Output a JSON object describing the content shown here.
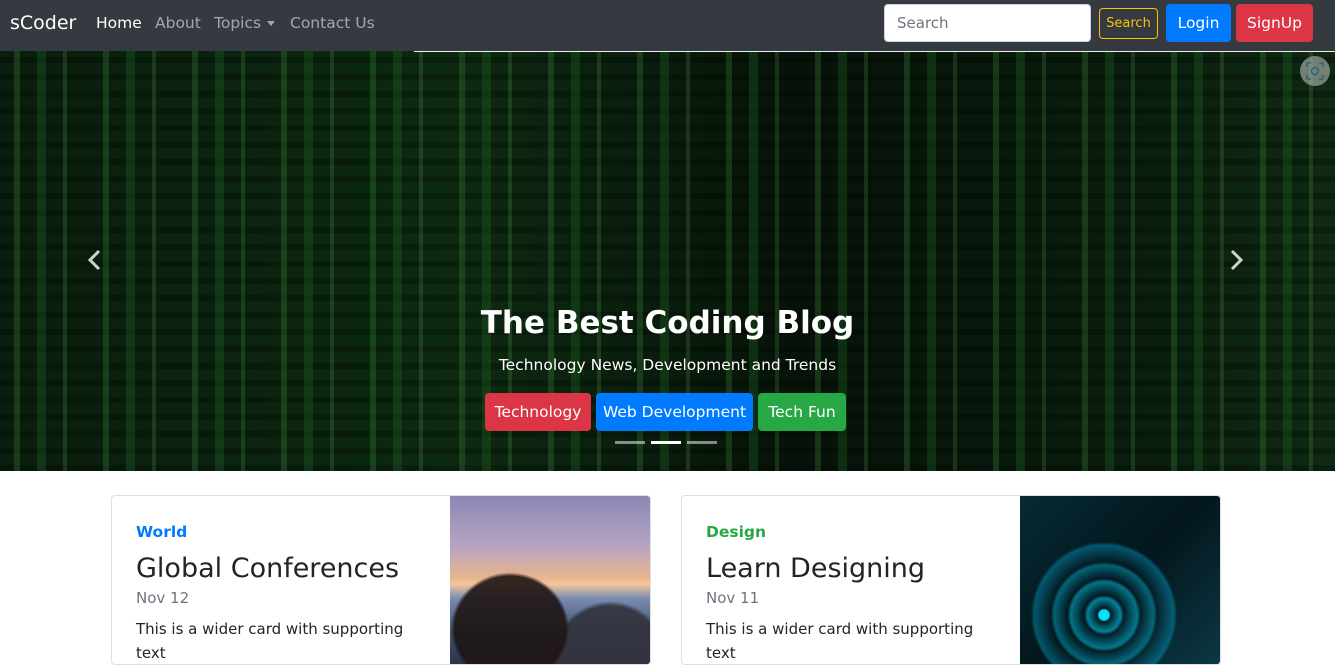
{
  "navbar": {
    "brand": "sCoder",
    "links": [
      {
        "label": "Home",
        "active": true
      },
      {
        "label": "About",
        "active": false
      },
      {
        "label": "Topics",
        "active": false,
        "dropdown": true
      },
      {
        "label": "Contact Us",
        "active": false
      }
    ],
    "search_placeholder": "Search",
    "search_button": "Search",
    "login_button": "Login",
    "signup_button": "SignUp"
  },
  "hero": {
    "title": "The Best Coding Blog",
    "subtitle": "Technology News, Development and Trends",
    "buttons": [
      "Technology",
      "Web Development",
      "Tech Fun"
    ],
    "active_slide": 2,
    "slide_count": 3
  },
  "cards": [
    {
      "category": "World",
      "title": "Global Conferences",
      "date": "Nov 12",
      "text": "This is a wider card with supporting text"
    },
    {
      "category": "Design",
      "title": "Learn Designing",
      "date": "Nov 11",
      "text": "This is a wider card with supporting text"
    }
  ],
  "colors": {
    "navbar_bg": "#343a40",
    "primary": "#007bff",
    "danger": "#dc3545",
    "success": "#28a745",
    "warning": "#ffc107"
  },
  "icons": {
    "prev": "chevron-left-icon",
    "next": "chevron-right-icon",
    "scan": "scan-icon"
  }
}
